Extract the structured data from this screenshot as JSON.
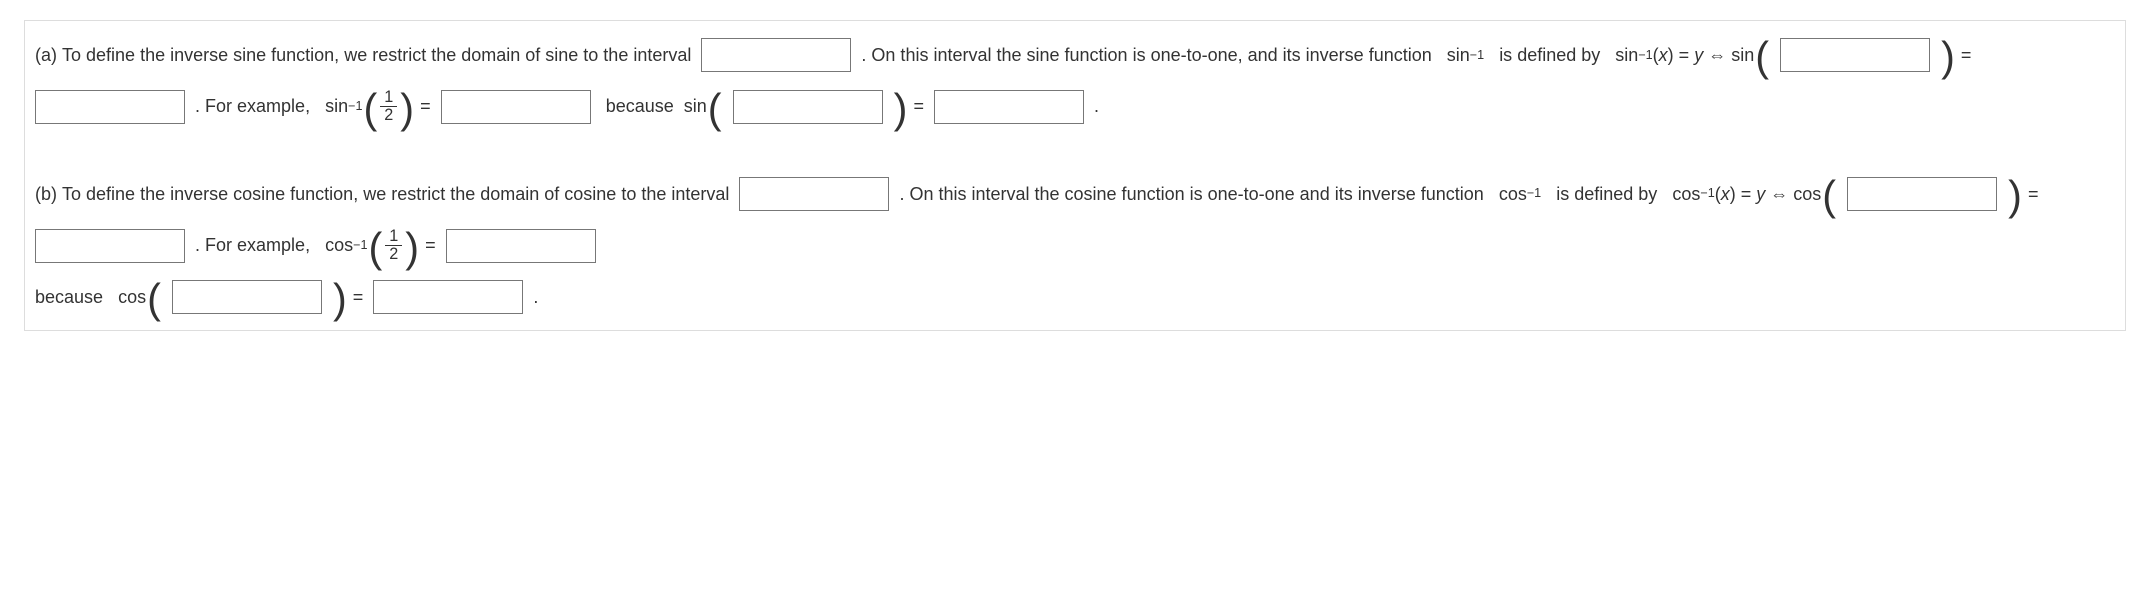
{
  "a": {
    "prefix": "(a)",
    "t1": "To define the inverse sine function, we restrict the domain of sine to the interval",
    "t2": ". On this interval the sine function is one-to-one, and its inverse function",
    "fn_inv": "sin",
    "neg1": "−1",
    "t3": "is defined by",
    "eq_lhs_fn": "sin",
    "x": "x",
    "y_eq": "y",
    "iff": "⇔",
    "op_fn": "sin",
    "eq": "=",
    "t4": ". For example,",
    "half_num": "1",
    "half_den": "2",
    "t5": "because",
    "period": "."
  },
  "b": {
    "prefix": "(b)",
    "t1": "To define the inverse cosine function, we restrict the domain of cosine to the interval",
    "t2": ". On this interval the cosine function is one-to-one and its inverse function",
    "fn_inv": "cos",
    "neg1": "−1",
    "t3": "is defined by",
    "eq_lhs_fn": "cos",
    "x": "x",
    "y_eq": "y",
    "iff": "⇔",
    "op_fn": "cos",
    "eq": "=",
    "t4": ". For example,",
    "half_num": "1",
    "half_den": "2",
    "t5": "because",
    "period": "."
  }
}
